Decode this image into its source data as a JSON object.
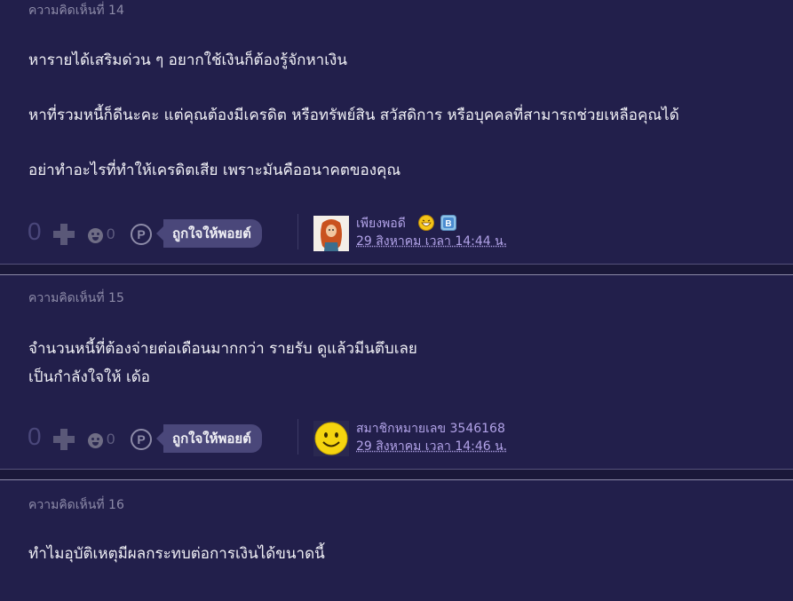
{
  "comments": [
    {
      "title": "ความคิดเห็นที่ 14",
      "paragraphs": [
        "หารายได้เสริมด่วน ๆ อยากใช้เงินก็ต้องรู้จักหาเงิน",
        "หาที่รวมหนี้ก็ดีนะคะ แต่คุณต้องมีเครดิต หรือทรัพย์สิน สวัสดิการ หรือบุคคลที่สามารถช่วยเหลือคุณได้",
        "อย่าทำอะไรที่ทำให้เครดิตเสีย เพราะมันคืออนาคตของคุณ"
      ],
      "vote_count": "0",
      "emoji_count": "0",
      "point_label": "P",
      "like_label": "ถูกใจให้พอยต์",
      "author": "เพียงพอดี",
      "timestamp": "29 สิงหาคม เวลา 14:44 น.",
      "avatar_icon": "redhead-character-avatar-icon",
      "badges": [
        "laughing-emoji-icon",
        "blue-b-badge-icon"
      ]
    },
    {
      "title": "ความคิดเห็นที่ 15",
      "paragraphs": [
        "จำนวนหนี้ที่ต้องจ่ายต่อเดือนมากกว่า รายรับ  ดูแล้วมีนตึบเลย",
        "เป็นกำลังใจให้ เด้อ"
      ],
      "vote_count": "0",
      "emoji_count": "0",
      "point_label": "P",
      "like_label": "ถูกใจให้พอยต์",
      "author": "สมาชิกหมายเลข 3546168",
      "timestamp": "29 สิงหาคม เวลา 14:46 น.",
      "avatar_icon": "yellow-smiley-avatar-icon",
      "badges": []
    },
    {
      "title": "ความคิดเห็นที่ 16",
      "paragraphs": [
        "ทำไมอุบัติเหตุมีผลกระทบต่อการเงินได้ขนาดนี้"
      ]
    }
  ],
  "colors": {
    "background": "#1f1d45",
    "comment_bg": "#221f4b",
    "text": "#f1f1f6",
    "muted_text": "#8d8ba8",
    "link": "#b2a3e8",
    "button": "#4a477a"
  }
}
